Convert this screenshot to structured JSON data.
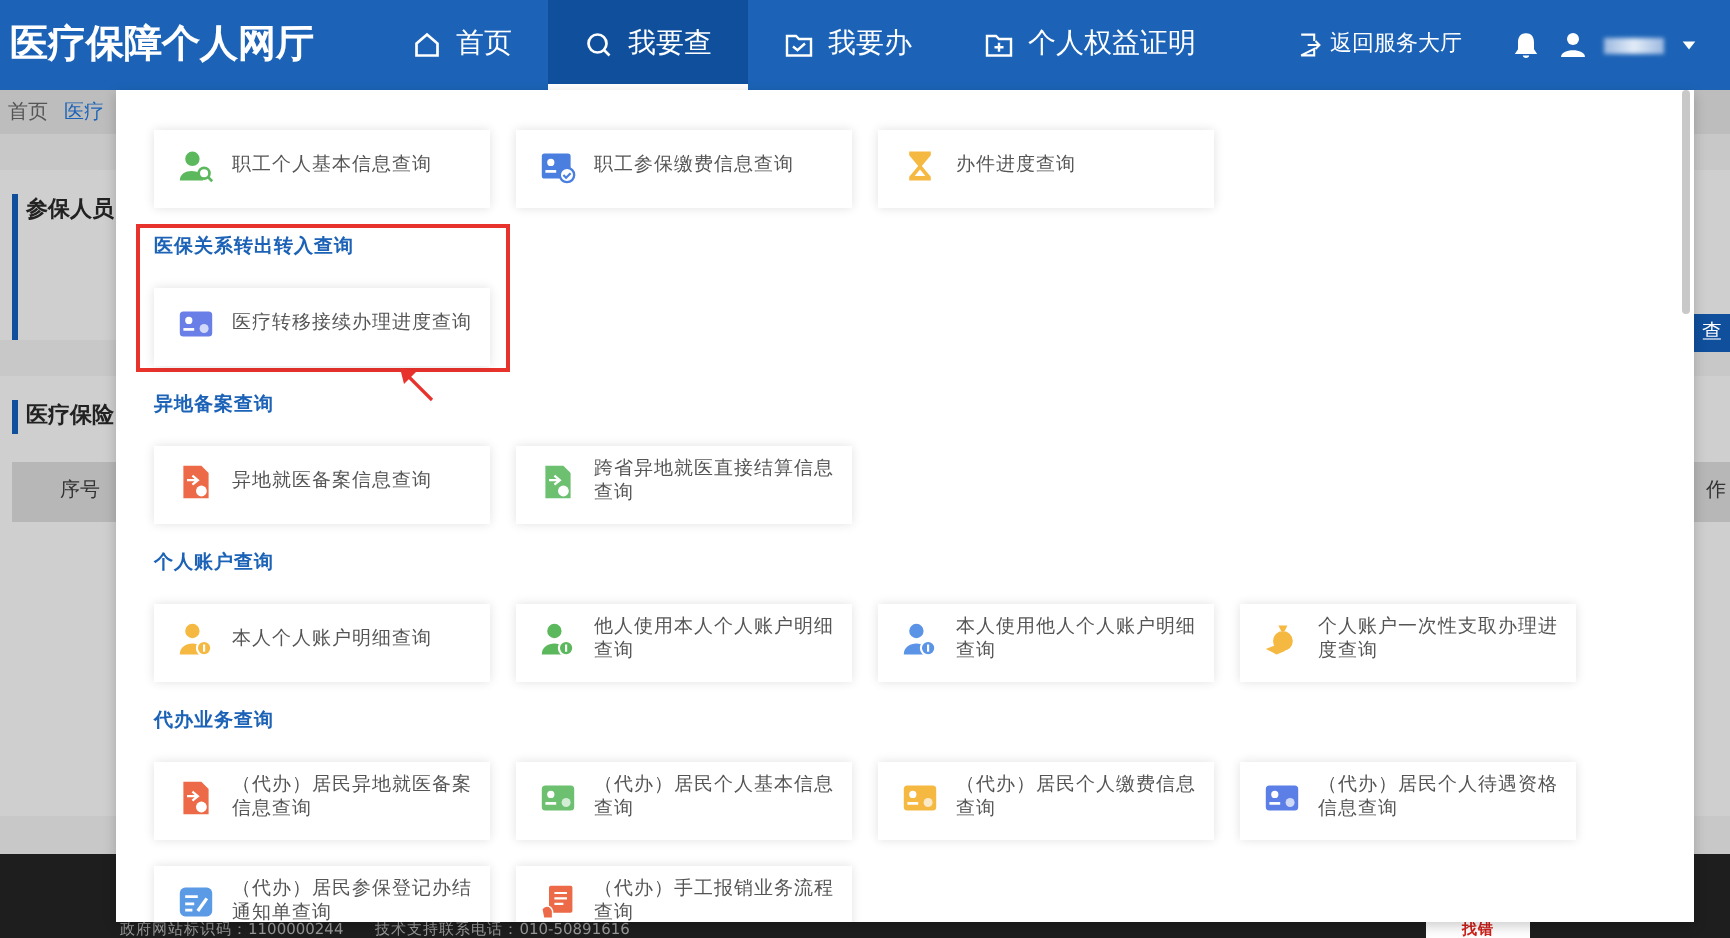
{
  "header": {
    "logo": "医疗保障个人网厅",
    "nav": [
      {
        "label": "首页",
        "selected": false
      },
      {
        "label": "我要查",
        "selected": true
      },
      {
        "label": "我要办",
        "selected": false
      },
      {
        "label": "个人权益证明",
        "selected": false
      }
    ],
    "back_link": "返回服务大厅"
  },
  "background_page": {
    "breadcrumb": [
      "首页",
      "医疗"
    ],
    "panel_1_title": "参保人员",
    "panel_2_title": "医疗保险",
    "table_header": "序号",
    "right_button": "查",
    "right_header": "作"
  },
  "dropdown": {
    "sections": [
      {
        "highlighted": false,
        "items": [
          {
            "label": "职工个人基本信息查询",
            "kind": "person-search",
            "color": "#5cb85c"
          },
          {
            "label": "职工参保缴费信息查询",
            "kind": "card-check",
            "color": "#4a7fe0"
          },
          {
            "label": "办件进度查询",
            "kind": "hourglass",
            "color": "#f5b942"
          }
        ]
      },
      {
        "heading": "医保关系转出转入查询",
        "highlighted": true,
        "items": [
          {
            "label": "医疗转移接续办理进度查询",
            "kind": "card",
            "color": "#6a7ee8"
          }
        ]
      },
      {
        "heading": "异地备案查询",
        "highlighted": false,
        "items": [
          {
            "label": "异地就医备案信息查询",
            "kind": "file",
            "color": "#ec6a47"
          },
          {
            "label": "跨省异地就医直接结算信息查询",
            "kind": "file",
            "color": "#6cc070"
          }
        ]
      },
      {
        "heading": "个人账户查询",
        "highlighted": false,
        "items": [
          {
            "label": "本人个人账户明细查询",
            "kind": "person-coin",
            "color": "#f5b942"
          },
          {
            "label": "他人使用本人个人账户明细查询",
            "kind": "person-coin",
            "color": "#5cb85c"
          },
          {
            "label": "本人使用他人个人账户明细查询",
            "kind": "person-coin",
            "color": "#5b93e6"
          },
          {
            "label": "个人账户一次性支取办理进度查询",
            "kind": "bag",
            "color": "#f5b942"
          }
        ]
      },
      {
        "heading": "代办业务查询",
        "highlighted": false,
        "items": [
          {
            "label": "（代办）居民异地就医备案信息查询",
            "kind": "file",
            "color": "#ec6a47"
          },
          {
            "label": "（代办）居民个人基本信息查询",
            "kind": "card",
            "color": "#6cc070"
          },
          {
            "label": "（代办）居民个人缴费信息查询",
            "kind": "card",
            "color": "#f5b942"
          },
          {
            "label": "（代办）居民个人待遇资格信息查询",
            "kind": "card",
            "color": "#5b7fe6"
          },
          {
            "label": "（代办）居民参保登记办结通知单查询",
            "kind": "form",
            "color": "#5b9be6"
          },
          {
            "label": "（代办）手工报销业务流程查询",
            "kind": "doc",
            "color": "#ec6a47"
          }
        ]
      }
    ]
  },
  "footer": {
    "texts": [
      "政府网站标识码：1100000244",
      "技术支持联系电话：010-50891616"
    ],
    "badge": "找错"
  }
}
